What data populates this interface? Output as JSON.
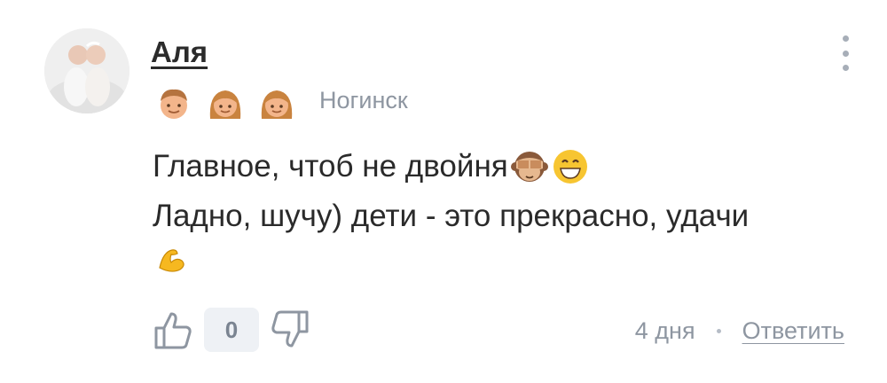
{
  "comment": {
    "author": "Аля",
    "badges": [
      "boy-face-icon",
      "girl-face-icon",
      "girl-face-icon"
    ],
    "city": "Ногинск",
    "text_lines": [
      "Главное, чтоб не двойня",
      "Ладно, шучу) дети - это прекрасно, удачи"
    ],
    "emojis": [
      "see-no-evil-monkey-icon",
      "grinning-face-icon",
      "flexed-biceps-icon"
    ],
    "likes_count": "0",
    "time_ago": "4 дня",
    "reply_label": "Ответить"
  },
  "colors": {
    "muted": "#8e96a1",
    "count_bg": "#eef1f5",
    "text": "#2a2a2a"
  }
}
